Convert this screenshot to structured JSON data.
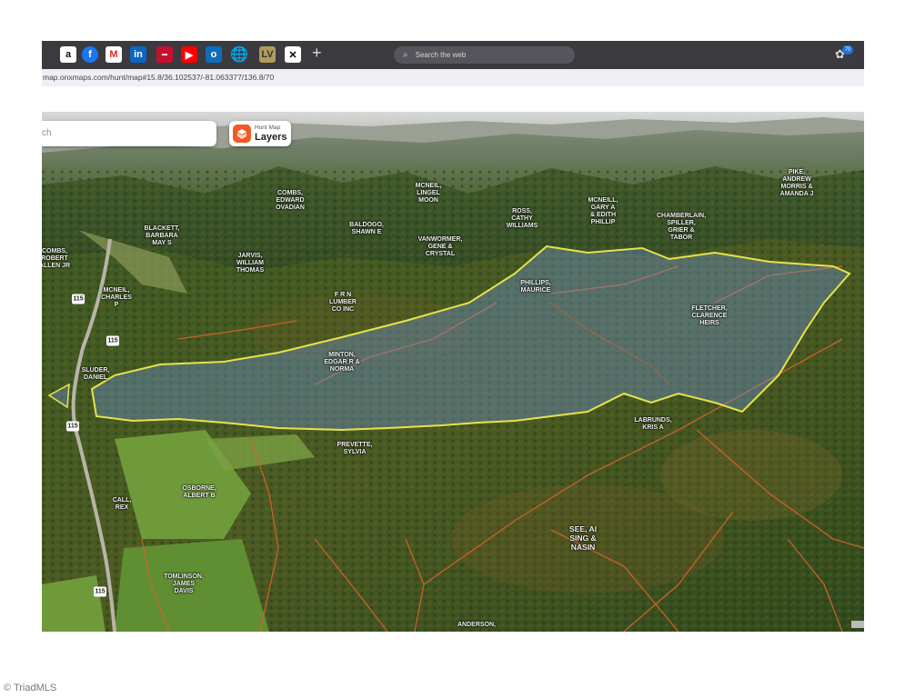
{
  "browser": {
    "toolbar_icons": [
      "amazon-icon",
      "facebook-icon",
      "gmail-icon",
      "linkedin-icon",
      "news-icon",
      "youtube-icon",
      "outlook-icon",
      "globe-icon",
      "notebook-icon",
      "x-icon"
    ],
    "new_tab": "+",
    "search_placeholder": "Search the web",
    "badge_count": "70",
    "url": "map.onxmaps.com/hunt/map#15.8/36.102537/-81.063377/136.8/70"
  },
  "map_ui": {
    "search_text": "ch",
    "layers_small": "Hunt Map",
    "layers_label": "Layers"
  },
  "map": {
    "parcel_labels": [
      {
        "text": "PHILLIPS,\nMAURICE"
      },
      {
        "text": "FLETCHER,\nCLARENCE\nHEIRS"
      },
      {
        "text": "MINTON,\nEDGAR R &\nNORMA"
      },
      {
        "text": "F R N\nLUMBER\nCO INC"
      },
      {
        "text": "PREVETTE,\nSYLVIA"
      },
      {
        "text": "LABRUNDS,\nKRIS A"
      },
      {
        "text": "SEE, AI\nSING &\nNASIN"
      },
      {
        "text": "OSBORNE,\nALBERT B"
      },
      {
        "text": "TOMLINSON,\nJAMES\nDAVIS"
      },
      {
        "text": "CALL,\nREX"
      },
      {
        "text": "ANDERSON,"
      },
      {
        "text": "SLUDER,\nDANIEL"
      },
      {
        "text": "JARVIS,\nWILLIAM\nTHOMAS"
      },
      {
        "text": "MCNEIL,\nCHARLES\nP"
      },
      {
        "text": "COMBS,\nROBERT\nALLEN JR"
      },
      {
        "text": "BLACKETT,\nBARBARA\nMAY S"
      },
      {
        "text": "BALDOGO,\nSHAWN E"
      },
      {
        "text": "VANWORMER,\nGENE &\nCRYSTAL"
      },
      {
        "text": "ROSS,\nCATHY\nWILLIAMS"
      },
      {
        "text": "COMBS,\nEDWARD\nOVADIAN"
      },
      {
        "text": "MCNEIL,\nLINGEL\nMOON"
      },
      {
        "text": "CHAMBERLAIN,\nSPILLER,\nGRIER &\nTABOR"
      },
      {
        "text": "MCNEILL,\nGARY A\n& EDITH\nPHILLIP"
      },
      {
        "text": "PIKE,\nANDREW\nMORRIS &\nAMANDA J"
      }
    ],
    "route_shields": [
      "115",
      "115",
      "115",
      "115"
    ]
  },
  "footer": {
    "copyright": "© TriadMLS"
  }
}
